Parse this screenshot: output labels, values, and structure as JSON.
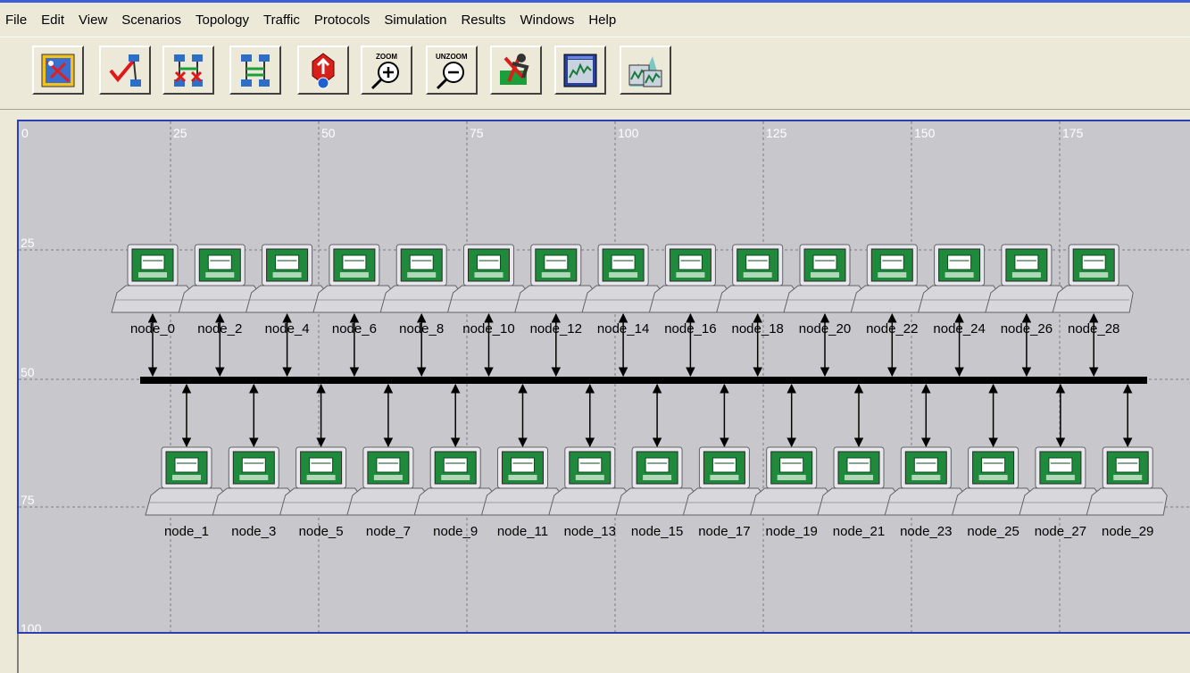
{
  "menu": [
    "File",
    "Edit",
    "View",
    "Scenarios",
    "Topology",
    "Traffic",
    "Protocols",
    "Simulation",
    "Results",
    "Windows",
    "Help"
  ],
  "toolbar": {
    "buttons": [
      {
        "name": "palette-icon"
      },
      {
        "name": "verify-links-icon"
      },
      {
        "name": "failed-links-icon"
      },
      {
        "name": "recover-links-icon"
      },
      {
        "name": "implement-icon"
      },
      {
        "name": "zoom-icon",
        "caption": "ZOOM"
      },
      {
        "name": "unzoom-icon",
        "caption": "UNZOOM"
      },
      {
        "name": "run-simulation-icon"
      },
      {
        "name": "view-results-icon"
      },
      {
        "name": "hide-graphs-icon"
      }
    ]
  },
  "grid": {
    "x_ticks": [
      "0",
      "25",
      "50",
      "75",
      "100",
      "125",
      "150",
      "175"
    ],
    "y_ticks": [
      "25",
      "50",
      "75",
      "100"
    ]
  },
  "nodes_top": [
    "node_0",
    "node_2",
    "node_4",
    "node_6",
    "node_8",
    "node_10",
    "node_12",
    "node_14",
    "node_16",
    "node_18",
    "node_20",
    "node_22",
    "node_24",
    "node_26",
    "node_28"
  ],
  "nodes_bottom": [
    "node_1",
    "node_3",
    "node_5",
    "node_7",
    "node_9",
    "node_11",
    "node_13",
    "node_15",
    "node_17",
    "node_19",
    "node_21",
    "node_23",
    "node_25",
    "node_27",
    "node_29"
  ],
  "colors": {
    "canvas": "#c8c8cc",
    "screen": "#1f8a3c",
    "bus": "#000000",
    "grid": "#7a7a80"
  }
}
